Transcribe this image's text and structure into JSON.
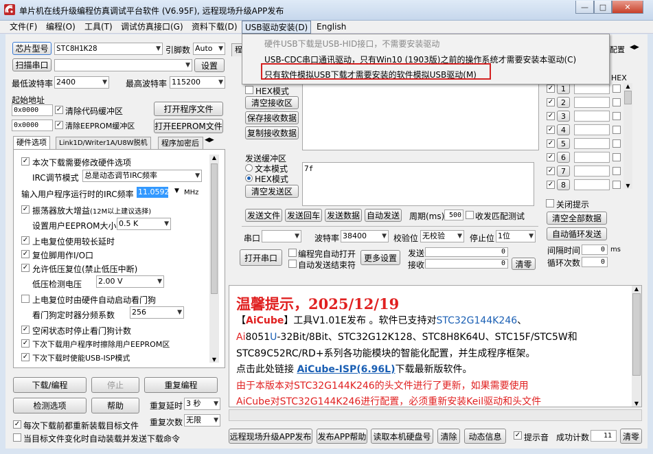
{
  "window": {
    "title": "单片机在线升级编程仿真调试平台软件 (V6.95F), 远程现场升级APP发布",
    "minimize": "—",
    "maximize": "□",
    "close": "✕"
  },
  "menu": [
    {
      "label": "文件(F)"
    },
    {
      "label": "编程(O)"
    },
    {
      "label": "工具(T)"
    },
    {
      "label": "调试仿真接口(G)"
    },
    {
      "label": "资料下载(D)"
    },
    {
      "label": "USB驱动安装(D)"
    },
    {
      "label": "English"
    }
  ],
  "dropdown_menu": {
    "items": [
      {
        "label": "硬件USB下载是USB-HID接口，不需要安装驱动"
      },
      {
        "label": "USB-CDC串口通讯驱动，只有Win10 (1903版)之前的操作系统才需要安装本驱动(C)"
      },
      {
        "label": "只有软件模拟USB下载才需要安装的软件模拟USB驱动(M)"
      }
    ]
  },
  "left": {
    "chip_type_button": "芯片型号",
    "chip_model": "STC8H1K28",
    "pins_label": "引脚数",
    "pins_value": "Auto",
    "scan_port_button": "扫描串口",
    "port_value": "",
    "settings_button": "设置",
    "min_baud_label": "最低波特率",
    "min_baud": "2400",
    "max_baud_label": "最高波特率",
    "max_baud": "115200",
    "start_addr_label": "起始地址",
    "code_addr": "0x0000",
    "clear_code_label": "清除代码缓冲区",
    "open_program_button": "打开程序文件",
    "eeprom_addr": "0x0000",
    "clear_eeprom_label": "清除EEPROM缓冲区",
    "open_eeprom_button": "打开EEPROM文件",
    "tabs": [
      {
        "label": "硬件选项"
      },
      {
        "label": "Link1D/Writer1A/U8W脱机"
      },
      {
        "label": "程序加密后"
      }
    ],
    "options": {
      "modify_hw": "本次下载需要修改硬件选项",
      "irc_mode_label": "IRC调节模式",
      "irc_mode_value": "总是动态调节IRC频率",
      "irc_freq_label": "输入用户程序运行时的IRC频率",
      "irc_freq_value": "11.0592",
      "irc_unit": "MHz",
      "amp_gain": "振荡器放大增益",
      "amp_gain_note": "(12M以上建议选择)",
      "eeprom_size_label": "设置用户EEPROM大小",
      "eeprom_size_value": "0.5 K",
      "long_reset": "上电复位使用较长延时",
      "reset_io": "复位脚用作I/O口",
      "lvr": "允许低压复位(禁止低压中断)",
      "lvd_label": "低压检测电压",
      "lvd_value": "2.00 V",
      "wdt_auto": "上电复位时由硬件自动启动看门狗",
      "wdt_div_label": "看门狗定时器分频系数",
      "wdt_div_value": "256",
      "idle_stop_wdt": "空闲状态时停止看门狗计数",
      "erase_eeprom": "下次下载用户程序时擦除用户EEPROM区",
      "usb_isp": "下次下载时使能USB-ISP模式"
    },
    "download_button": "下载/编程",
    "stop_button": "停止",
    "reprogram_button": "重复编程",
    "check_options_button": "检测选项",
    "help_button": "帮助",
    "repeat_delay_label": "重复延时",
    "repeat_delay_value": "3 秒",
    "repeat_count_label": "重复次数",
    "repeat_count_value": "无限",
    "reload_label": "每次下载前都重新装载目标文件",
    "auto_send_label": "当目标文件变化时自动装载并发送下载命令"
  },
  "serial": {
    "tab_prog": "程",
    "tab_right": "配置",
    "hex_mode_label": "HEX模式",
    "clear_recv_button": "清空接收区",
    "save_recv_button": "保存接收数据",
    "copy_recv_button": "复制接收数据",
    "send_buffer_label": "发送缓冲区",
    "text_mode_label": "文本模式",
    "hex_mode2_label": "HEX模式",
    "clear_send_button": "清空发送区",
    "send_content": "7f",
    "send_file_button": "发送文件",
    "send_enter_button": "发送回车",
    "send_data_button": "发送数据",
    "auto_send_button": "自动发送",
    "period_label": "周期(ms)",
    "period_value": "500",
    "match_test_label": "收发匹配测试",
    "port_label": "串口",
    "port_value": "",
    "baud_label": "波特率",
    "baud_value": "38400",
    "parity_label": "校验位",
    "parity_value": "无校验",
    "stop_bits_label": "停止位",
    "stop_bits_value": "1位",
    "open_port_button": "打开串口",
    "auto_open_label": "编程完自动打开",
    "auto_send_end_label": "自动发送结束符",
    "more_settings_button": "更多设置",
    "send_count_label": "发送",
    "send_count": "0",
    "recv_count_label": "接收",
    "recv_count": "0",
    "clear_count_button": "清零"
  },
  "multi": {
    "hex_header": "HEX",
    "rows": [
      {
        "label": "1"
      },
      {
        "label": "2"
      },
      {
        "label": "3"
      },
      {
        "label": "4"
      },
      {
        "label": "5"
      },
      {
        "label": "6"
      },
      {
        "label": "7"
      },
      {
        "label": "8"
      }
    ],
    "close_tip_label": "关闭提示",
    "clear_all_button": "清空全部数据",
    "auto_loop_button": "自动循环发送",
    "interval_label": "间隔时间",
    "interval_value": "0",
    "interval_unit": "ms",
    "loop_count_label": "循环次数",
    "loop_count": "0"
  },
  "tips": {
    "title": "温馨提示，2025/12/19",
    "line1_a": "【",
    "line1_b": "AiCube",
    "line1_c": "】工具V1.01E发布 。软件已支持对",
    "line1_d": "STC32G144K246",
    "line1_e": "、",
    "line2_a": "Ai",
    "line2_b": "8051",
    "line2_c": "U",
    "line2_d": "-32Bit/8Bit、STC32G12K128、STC8H8K64U、STC15F/STC5W和",
    "line3": "STC89C52RC/RD+系列各功能模块的智能化配置，并生成程序框架。",
    "line4_a": "点击此处链接 ",
    "line4_b": "AiCube-ISP(6.96L)",
    "line4_c": "下载最新版软件。",
    "line5": "由于本版本对STC32G144K246的头文件进行了更新，如果需要使用",
    "line6": "AiCube对STC32G144K246进行配置，必须重新安装Keil驱动和头文件"
  },
  "bottom": {
    "remote_upgrade_button": "远程现场升级APP发布",
    "publish_help_button": "发布APP帮助",
    "read_disk_button": "读取本机硬盘号",
    "clear_button": "清除",
    "animation_button": "动态信息",
    "beep_label": "提示音",
    "success_label": "成功计数",
    "success_count": "11",
    "clear_success_button": "清零"
  }
}
